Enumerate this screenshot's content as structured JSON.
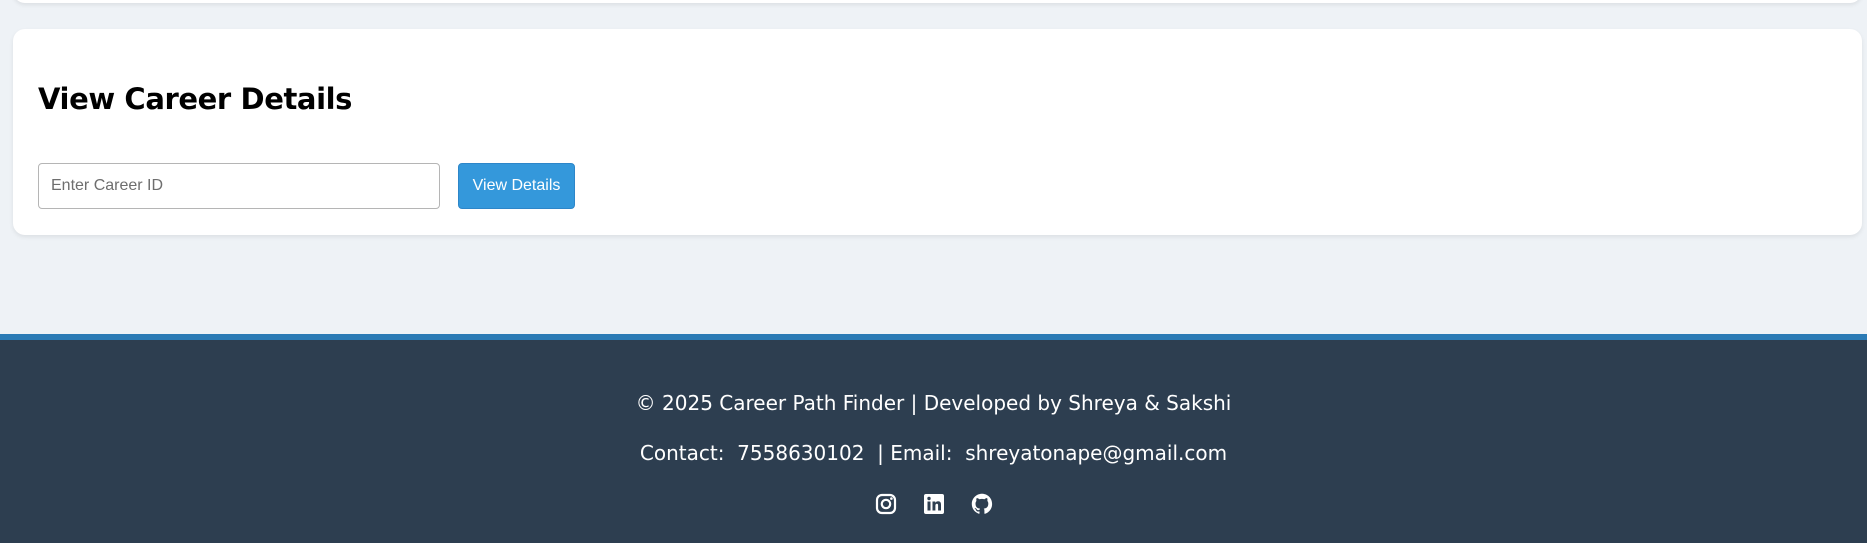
{
  "career_details": {
    "title": "View Career Details",
    "input_placeholder": "Enter Career ID",
    "input_value": "",
    "button_label": "View Details"
  },
  "footer": {
    "copyright": "© 2025 Career Path Finder | Developed by Shreya & Sakshi",
    "contact_label": "Contact:",
    "phone": "7558630102",
    "email_label": "| Email:",
    "email": "shreyatonape@gmail.com",
    "socials": [
      {
        "name": "instagram",
        "icon": "instagram-icon"
      },
      {
        "name": "linkedin",
        "icon": "linkedin-icon"
      },
      {
        "name": "github",
        "icon": "github-icon"
      }
    ]
  },
  "colors": {
    "page_background": "#eef2f6",
    "card_background": "#ffffff",
    "button_accent": "#3498db",
    "footer_background": "#2d3e50",
    "footer_top_border": "#2b7bb5",
    "footer_text": "#ffffff"
  }
}
